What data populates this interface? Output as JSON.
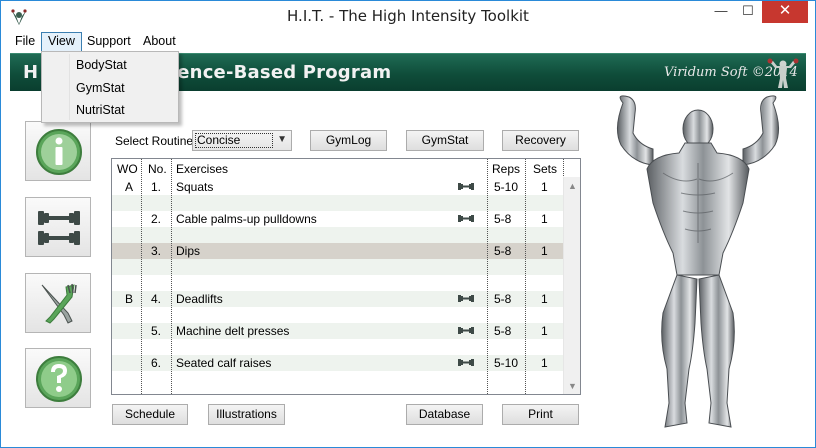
{
  "window": {
    "title": "H.I.T. - The High Intensity Toolkit"
  },
  "titlebar_buttons": {
    "minimize": "—",
    "maximize": "☐",
    "close": "✕"
  },
  "menu": {
    "items": [
      "File",
      "View",
      "Support",
      "About"
    ],
    "open_menu": "View"
  },
  "dropdown": {
    "items": [
      "BodyStat",
      "GymStat",
      "NutriStat"
    ]
  },
  "banner": {
    "title": "H.I.T. Evidence-Based Program",
    "visible_title_start": "H",
    "visible_title_end": "ence-Based Program",
    "signature": "Viridum Soft ©2014"
  },
  "sidebar": {
    "buttons": [
      "info-icon",
      "dumbbell-icon",
      "fork-knife-icon",
      "help-icon"
    ]
  },
  "routine": {
    "label": "Select Routine:",
    "selected": "Concise"
  },
  "toolbar": {
    "gymlog": "GymLog",
    "gymstat": "GymStat",
    "recovery": "Recovery"
  },
  "table": {
    "headers": {
      "wo": "WO",
      "no": "No.",
      "exercises": "Exercises",
      "reps": "Reps",
      "sets": "Sets"
    },
    "rows": [
      {
        "wo": "A",
        "no": "1.",
        "exercise": "Squats",
        "reps": "5-10",
        "sets": "1",
        "icon": true
      },
      {
        "wo": "",
        "no": "",
        "exercise": "",
        "reps": "",
        "sets": "",
        "icon": false
      },
      {
        "wo": "",
        "no": "2.",
        "exercise": "Cable palms-up pulldowns",
        "reps": "5-8",
        "sets": "1",
        "icon": true
      },
      {
        "wo": "",
        "no": "",
        "exercise": "",
        "reps": "",
        "sets": "",
        "icon": false
      },
      {
        "wo": "",
        "no": "3.",
        "exercise": "Dips",
        "reps": "5-8",
        "sets": "1",
        "icon": false,
        "selected": true
      },
      {
        "wo": "",
        "no": "",
        "exercise": "",
        "reps": "",
        "sets": "",
        "icon": false
      },
      {
        "wo": "",
        "no": "",
        "exercise": "",
        "reps": "",
        "sets": "",
        "icon": false
      },
      {
        "wo": "B",
        "no": "4.",
        "exercise": "Deadlifts",
        "reps": "5-8",
        "sets": "1",
        "icon": true
      },
      {
        "wo": "",
        "no": "",
        "exercise": "",
        "reps": "",
        "sets": "",
        "icon": false
      },
      {
        "wo": "",
        "no": "5.",
        "exercise": "Machine delt presses",
        "reps": "5-8",
        "sets": "1",
        "icon": true
      },
      {
        "wo": "",
        "no": "",
        "exercise": "",
        "reps": "",
        "sets": "",
        "icon": false
      },
      {
        "wo": "",
        "no": "6.",
        "exercise": "Seated calf raises",
        "reps": "5-10",
        "sets": "1",
        "icon": true
      },
      {
        "wo": "",
        "no": "",
        "exercise": "",
        "reps": "",
        "sets": "",
        "icon": false
      }
    ]
  },
  "bottom_buttons": {
    "schedule": "Schedule",
    "illustrations": "Illustrations",
    "database": "Database",
    "print": "Print"
  },
  "colors": {
    "banner": "#0f4d3a",
    "accent": "#3c7fb1",
    "selected_row": "#d6d2cb",
    "shaded_row": "#eef3ee",
    "close": "#c7372f"
  }
}
